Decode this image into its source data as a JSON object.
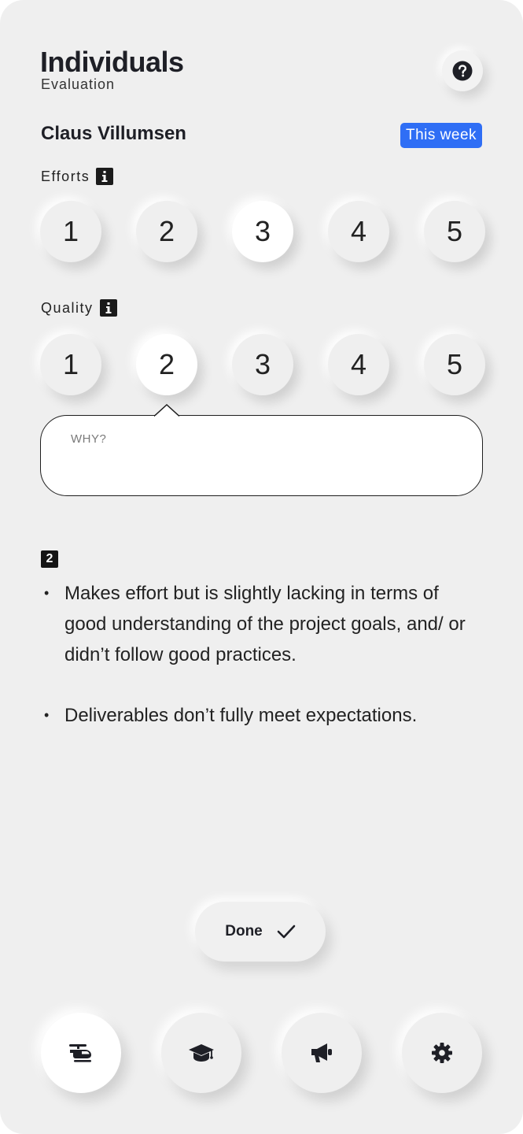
{
  "header": {
    "title": "Individuals",
    "subtitle": "Evaluation",
    "help_icon": "question-circle-icon"
  },
  "person": {
    "name": "Claus Villumsen",
    "period_badge": "This week",
    "badge_color": "#2f6ef5"
  },
  "efforts": {
    "label": "Efforts",
    "options": [
      "1",
      "2",
      "3",
      "4",
      "5"
    ],
    "selected": 3
  },
  "quality": {
    "label": "Quality",
    "options": [
      "1",
      "2",
      "3",
      "4",
      "5"
    ],
    "selected": 2
  },
  "why": {
    "placeholder": "WHY?",
    "value": ""
  },
  "description": {
    "level": "2",
    "bullets": [
      "Makes effort but is slightly lacking in terms of good understanding of the project goals, and/ or didn’t follow good practices.",
      "Deliverables don’t fully meet expectations."
    ]
  },
  "done": {
    "label": "Done",
    "icon": "check-icon"
  },
  "nav": {
    "items": [
      {
        "icon": "helicopter-icon",
        "active": true
      },
      {
        "icon": "graduation-cap-icon",
        "active": false
      },
      {
        "icon": "megaphone-icon",
        "active": false
      },
      {
        "icon": "gear-icon",
        "active": false
      }
    ]
  }
}
